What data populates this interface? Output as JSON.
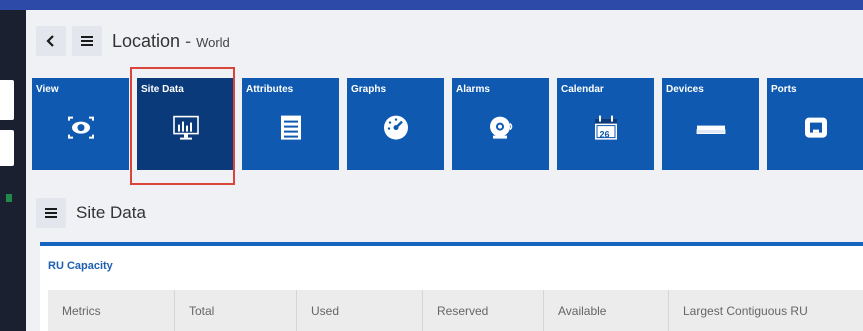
{
  "header": {
    "back_icon": "chevron-left-icon",
    "menu_icon": "hamburger-icon",
    "title": "Location",
    "separator": " - ",
    "subtitle": "World"
  },
  "tiles": [
    {
      "label": "View",
      "icon": "eye-scan-icon"
    },
    {
      "label": "Site Data",
      "icon": "bar-chart-monitor-icon",
      "active": true
    },
    {
      "label": "Attributes",
      "icon": "list-icon"
    },
    {
      "label": "Graphs",
      "icon": "gauge-icon"
    },
    {
      "label": "Alarms",
      "icon": "alarm-bell-icon"
    },
    {
      "label": "Calendar",
      "icon": "calendar-icon",
      "calendar_day": "26"
    },
    {
      "label": "Devices",
      "icon": "device-icon"
    },
    {
      "label": "Ports",
      "icon": "port-icon"
    }
  ],
  "section": {
    "menu_icon": "hamburger-icon",
    "title": "Site Data"
  },
  "card": {
    "title": "RU Capacity",
    "columns": [
      "Metrics",
      "Total",
      "Used",
      "Reserved",
      "Available",
      "Largest Contiguous RU"
    ]
  },
  "colors": {
    "tile_bg": "#0f5ab0",
    "tile_active_bg": "#0b3a7a",
    "highlight": "#d9453a",
    "accent": "#1565c0"
  }
}
